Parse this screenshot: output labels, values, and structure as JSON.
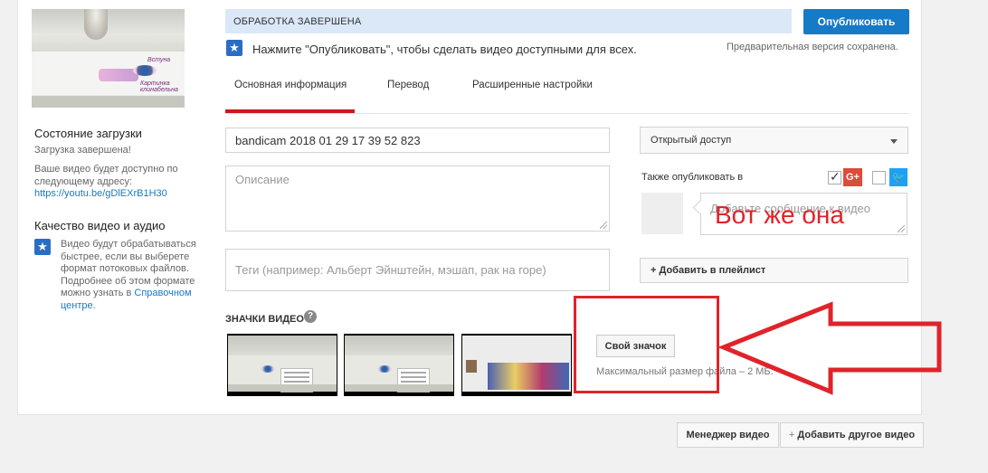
{
  "sidebar": {
    "upload_status_title": "Состояние загрузки",
    "upload_complete": "Загрузка завершена!",
    "available_text_1": "Ваше видео будет доступно по",
    "available_text_2": "следующему адресу:",
    "video_url": "https://youtu.be/gDlEXrB1H30",
    "quality_title": "Качество видео и аудио",
    "quality_text": "Видео будут обрабатываться быстрее, если вы выберете формат потоковых файлов. Подробнее об этом формате можно узнать в",
    "help_center_link": "Справочном центре",
    "help_center_suffix": ".",
    "preview_text_a": "Картинка клинабельна",
    "preview_text_b": "Встуна"
  },
  "status_bar": {
    "text": "ОБРАБОТКА ЗАВЕРШЕНА",
    "publish_button": "Опубликовать",
    "info": "Нажмите \"Опубликовать\", чтобы сделать видео доступными для всех.",
    "saved": "Предварительная версия сохранена."
  },
  "tabs": [
    {
      "label": "Основная информация",
      "active": true
    },
    {
      "label": "Перевод",
      "active": false
    },
    {
      "label": "Расширенные настройки",
      "active": false
    }
  ],
  "form": {
    "title_value": "bandicam 2018 01 29 17 39 52 823",
    "description_placeholder": "Описание",
    "tags_placeholder": "Теги (например: Альберт Эйнштейн, мэшап, рак на горе)",
    "privacy_value": "Открытый доступ",
    "also_publish_label": "Также опубликовать в",
    "message_placeholder": "Добавьте сообщение к видео",
    "add_playlist": "+ Добавить в плейлист",
    "gplus_checked": true,
    "twitter_checked": false
  },
  "thumbnails": {
    "heading": "ЗНАЧКИ ВИДЕО",
    "custom_button": "Свой значок",
    "max_size": "Максимальный размер файла – 2 МБ."
  },
  "annotation": {
    "text": "Вот же она",
    "color": "#e0232a"
  },
  "footer": {
    "video_manager": "Менеджер видео",
    "add_another": "Добавить другое видео"
  },
  "colors": {
    "accent": "#167ac6",
    "status_bg": "#dbe8f8",
    "tab_underline": "#cc181e"
  }
}
